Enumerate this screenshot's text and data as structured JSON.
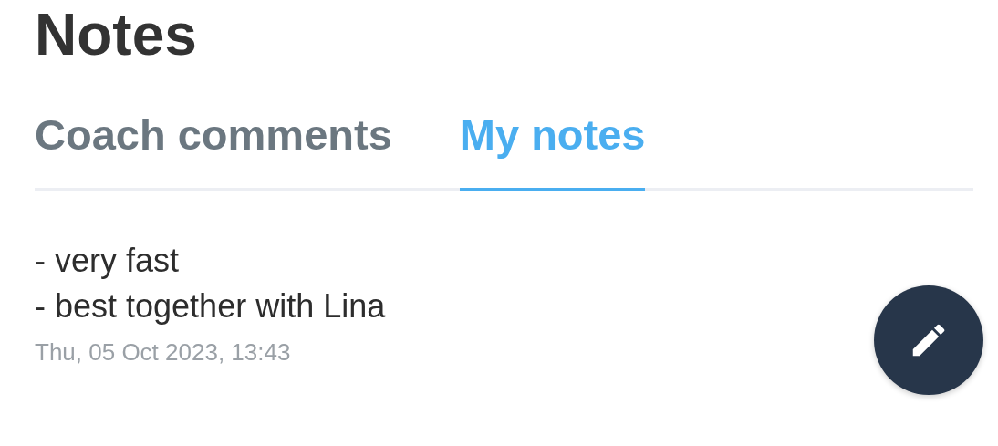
{
  "title": "Notes",
  "tabs": [
    {
      "label": "Coach comments",
      "selected": false
    },
    {
      "label": "My notes",
      "selected": true
    }
  ],
  "notes": [
    {
      "text": "- very fast\n- best together with Lina",
      "date": "Thu, 05 Oct 2023, 13:43"
    }
  ],
  "fab": {
    "kind": "edit"
  }
}
